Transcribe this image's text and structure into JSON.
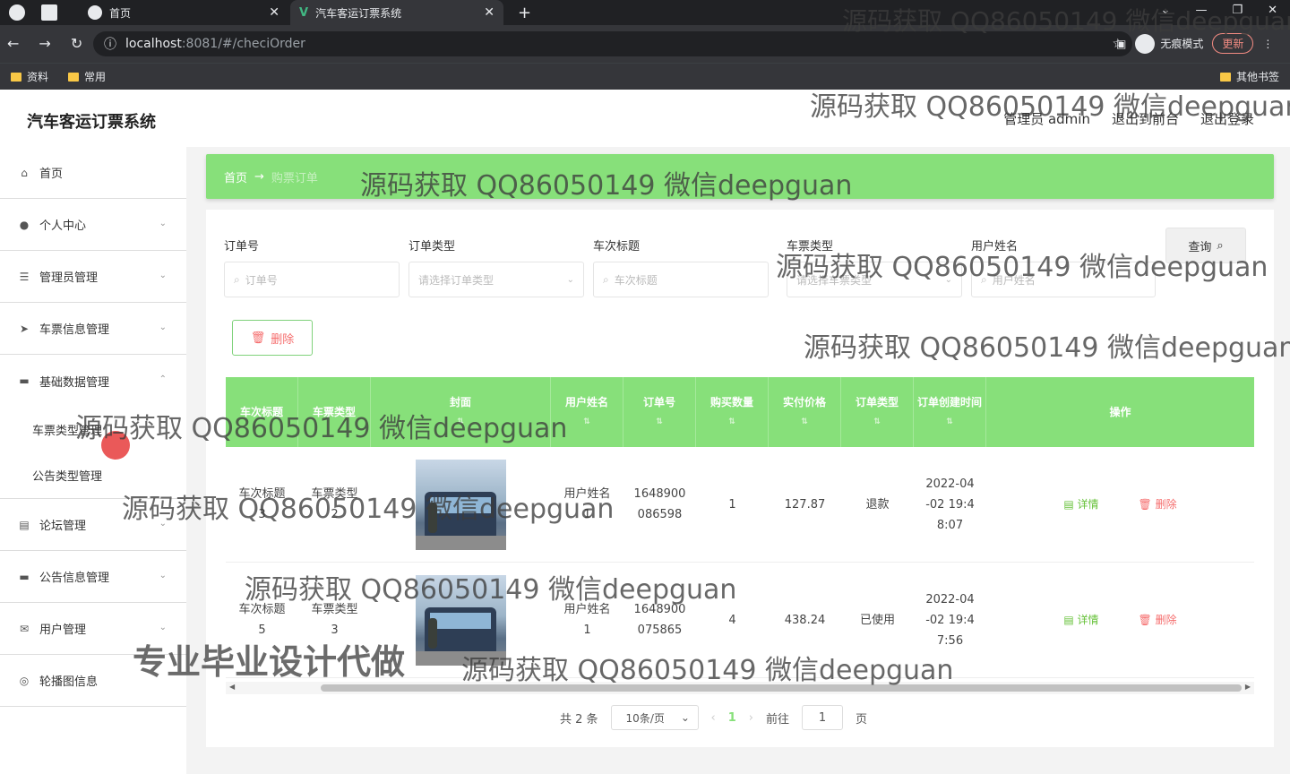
{
  "browser": {
    "tabs": [
      {
        "title": "首页"
      },
      {
        "title": "汽车客运订票系统"
      }
    ],
    "url_host": "localhost",
    "url_path": ":8081/#/checiOrder",
    "incognito_label": "无痕模式",
    "update_label": "更新",
    "bookmarks": [
      "资料",
      "常用"
    ],
    "other_bookmarks": "其他书签"
  },
  "app": {
    "title": "汽车客运订票系统",
    "header_links": [
      "管理员 admin",
      "退出到前台",
      "退出登录"
    ]
  },
  "sidebar": {
    "items": [
      {
        "label": "首页",
        "icon": "home-icon",
        "glyph": "⌂"
      },
      {
        "label": "个人中心",
        "icon": "user-icon",
        "glyph": "●"
      },
      {
        "label": "管理员管理",
        "icon": "list-icon",
        "glyph": "☰"
      },
      {
        "label": "车票信息管理",
        "icon": "send-icon",
        "glyph": "➤"
      },
      {
        "label": "基础数据管理",
        "icon": "monitor-icon",
        "glyph": "▬"
      }
    ],
    "subitems": [
      "车票类型管理",
      "公告类型管理"
    ],
    "items_after": [
      {
        "label": "论坛管理",
        "icon": "forum-icon",
        "glyph": "▤"
      },
      {
        "label": "公告信息管理",
        "icon": "notice-icon",
        "glyph": "▬"
      },
      {
        "label": "用户管理",
        "icon": "mail-icon",
        "glyph": "✉"
      },
      {
        "label": "轮播图信息",
        "icon": "image-icon",
        "glyph": "◎"
      }
    ]
  },
  "breadcrumb": {
    "home": "首页",
    "arrow": "→",
    "current": "购票订单"
  },
  "search": {
    "fields": [
      {
        "label": "订单号",
        "placeholder": "订单号"
      },
      {
        "label": "订单类型",
        "placeholder": "请选择订单类型"
      },
      {
        "label": "车次标题",
        "placeholder": "车次标题"
      },
      {
        "label": "车票类型",
        "placeholder": "请选择车票类型"
      },
      {
        "label": "用户姓名",
        "placeholder": "用户姓名"
      }
    ],
    "query_label": "查询"
  },
  "delete_label": "删除",
  "table": {
    "headers": [
      "车次标题",
      "车票类型",
      "封面",
      "用户姓名",
      "订单号",
      "购买数量",
      "实付价格",
      "订单类型",
      "订单创建时间",
      "操作"
    ],
    "rows": [
      {
        "title_line1": "车次标题",
        "title_line2": "3",
        "type_line1": "车票类型",
        "type_line2": "2",
        "user_line1": "用户姓名",
        "user_line2": "1",
        "order_line1": "1648900",
        "order_line2": "086598",
        "qty": "1",
        "price": "127.87",
        "status": "退款",
        "time_line1": "2022-04",
        "time_line2": "-02 19:4",
        "time_line3": "8:07"
      },
      {
        "title_line1": "车次标题",
        "title_line2": "5",
        "type_line1": "车票类型",
        "type_line2": "3",
        "user_line1": "用户姓名",
        "user_line2": "1",
        "order_line1": "1648900",
        "order_line2": "075865",
        "qty": "4",
        "price": "438.24",
        "status": "已使用",
        "time_line1": "2022-04",
        "time_line2": "-02 19:4",
        "time_line3": "7:56"
      }
    ],
    "detail_label": "详情",
    "delete_label": "删除"
  },
  "pager": {
    "total": "共 2 条",
    "size": "10条/页",
    "current": "1",
    "goto_prefix": "前往",
    "goto_value": "1",
    "goto_suffix": "页"
  },
  "watermarks": {
    "qq": "源码获取 QQ86050149 微信deepguan",
    "promo": "专业毕业设计代做"
  },
  "colors": {
    "accent": "#87e07a",
    "danger": "#f56c6c",
    "success": "#67c23a"
  }
}
